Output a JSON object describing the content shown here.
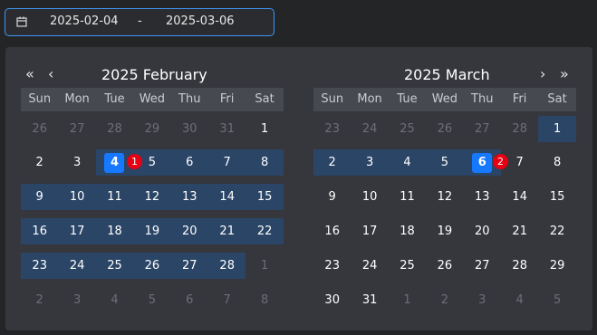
{
  "range": {
    "start": "2025-02-04",
    "separator": "-",
    "end": "2025-03-06"
  },
  "nav": {
    "prev_year": "«",
    "prev_month": "‹",
    "next_month": "›",
    "next_year": "»"
  },
  "left_title": "2025 February",
  "right_title": "2025 March",
  "weekdays": [
    "Sun",
    "Mon",
    "Tue",
    "Wed",
    "Thu",
    "Fri",
    "Sat"
  ],
  "left_days": [
    [
      "26",
      "27",
      "28",
      "29",
      "30",
      "31",
      "1"
    ],
    [
      "2",
      "3",
      "4",
      "5",
      "6",
      "7",
      "8"
    ],
    [
      "9",
      "10",
      "11",
      "12",
      "13",
      "14",
      "15"
    ],
    [
      "16",
      "17",
      "18",
      "19",
      "20",
      "21",
      "22"
    ],
    [
      "23",
      "24",
      "25",
      "26",
      "27",
      "28",
      "1"
    ],
    [
      "2",
      "3",
      "4",
      "5",
      "6",
      "7",
      "8"
    ]
  ],
  "right_days": [
    [
      "23",
      "24",
      "25",
      "26",
      "27",
      "28",
      "1"
    ],
    [
      "2",
      "3",
      "4",
      "5",
      "6",
      "7",
      "8"
    ],
    [
      "9",
      "10",
      "11",
      "12",
      "13",
      "14",
      "15"
    ],
    [
      "16",
      "17",
      "18",
      "19",
      "20",
      "21",
      "22"
    ],
    [
      "23",
      "24",
      "25",
      "26",
      "27",
      "28",
      "29"
    ],
    [
      "30",
      "31",
      "1",
      "2",
      "3",
      "4",
      "5"
    ]
  ],
  "badges": [
    "1",
    "2"
  ],
  "colors": {
    "accent": "#1677ff",
    "range_bg": "#2a4566",
    "badge": "#e60012"
  }
}
